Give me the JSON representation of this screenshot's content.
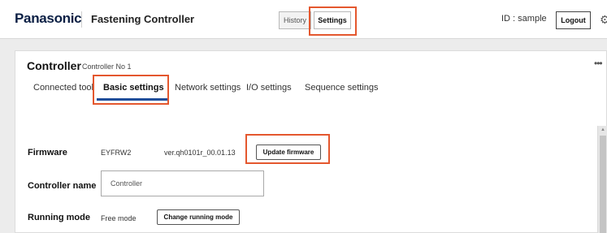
{
  "header": {
    "brand": "Panasonic",
    "app_title": "Fastening Controller",
    "history_label": "History",
    "settings_label": "Settings",
    "user_id": "ID : sample",
    "logout_label": "Logout",
    "settings_icon": "gear-icon"
  },
  "controller": {
    "title": "Controller",
    "subtitle": "Controller No 1",
    "more_icon": "more-icon"
  },
  "tabs": [
    {
      "label": "Connected tool",
      "selected": false
    },
    {
      "label": "Basic settings",
      "selected": true
    },
    {
      "label": "Network settings",
      "selected": false
    },
    {
      "label": "I/O settings",
      "selected": false
    },
    {
      "label": "Sequence settings",
      "selected": false
    }
  ],
  "form": {
    "firmware": {
      "label": "Firmware",
      "model": "EYFRW2",
      "version": "ver.qh0101r_00.01.13",
      "button_label": "Update firmware"
    },
    "controller_name": {
      "label": "Controller name",
      "value": "Controller"
    },
    "running_mode": {
      "label": "Running mode",
      "value": "Free mode",
      "button_label": "Change running mode"
    }
  },
  "colors": {
    "highlight": "#e4572e",
    "tab_underline": "#1f4d9a",
    "brand": "#0b1f44"
  }
}
